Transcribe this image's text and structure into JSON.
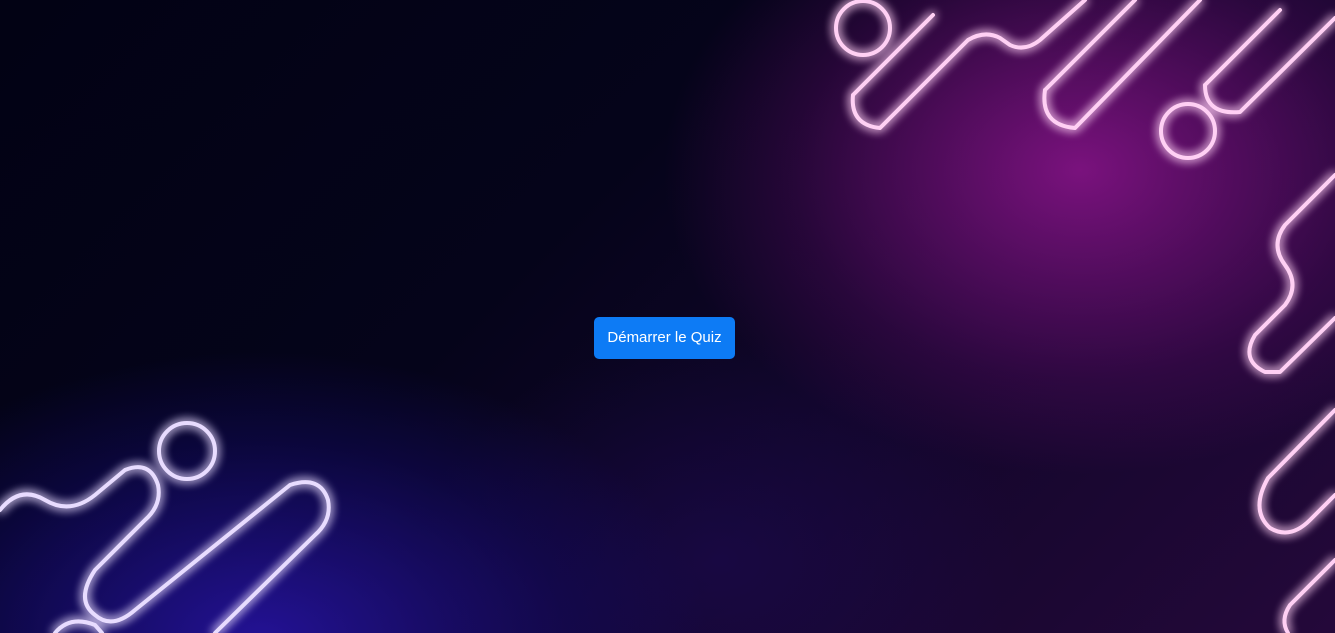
{
  "quiz": {
    "start_label": "Démarrer le Quiz"
  },
  "theme": {
    "button_color": "#0d7bf5",
    "neon_pink": "#ff4fd8",
    "neon_violet": "#9a6bff",
    "background": "#05041a"
  }
}
